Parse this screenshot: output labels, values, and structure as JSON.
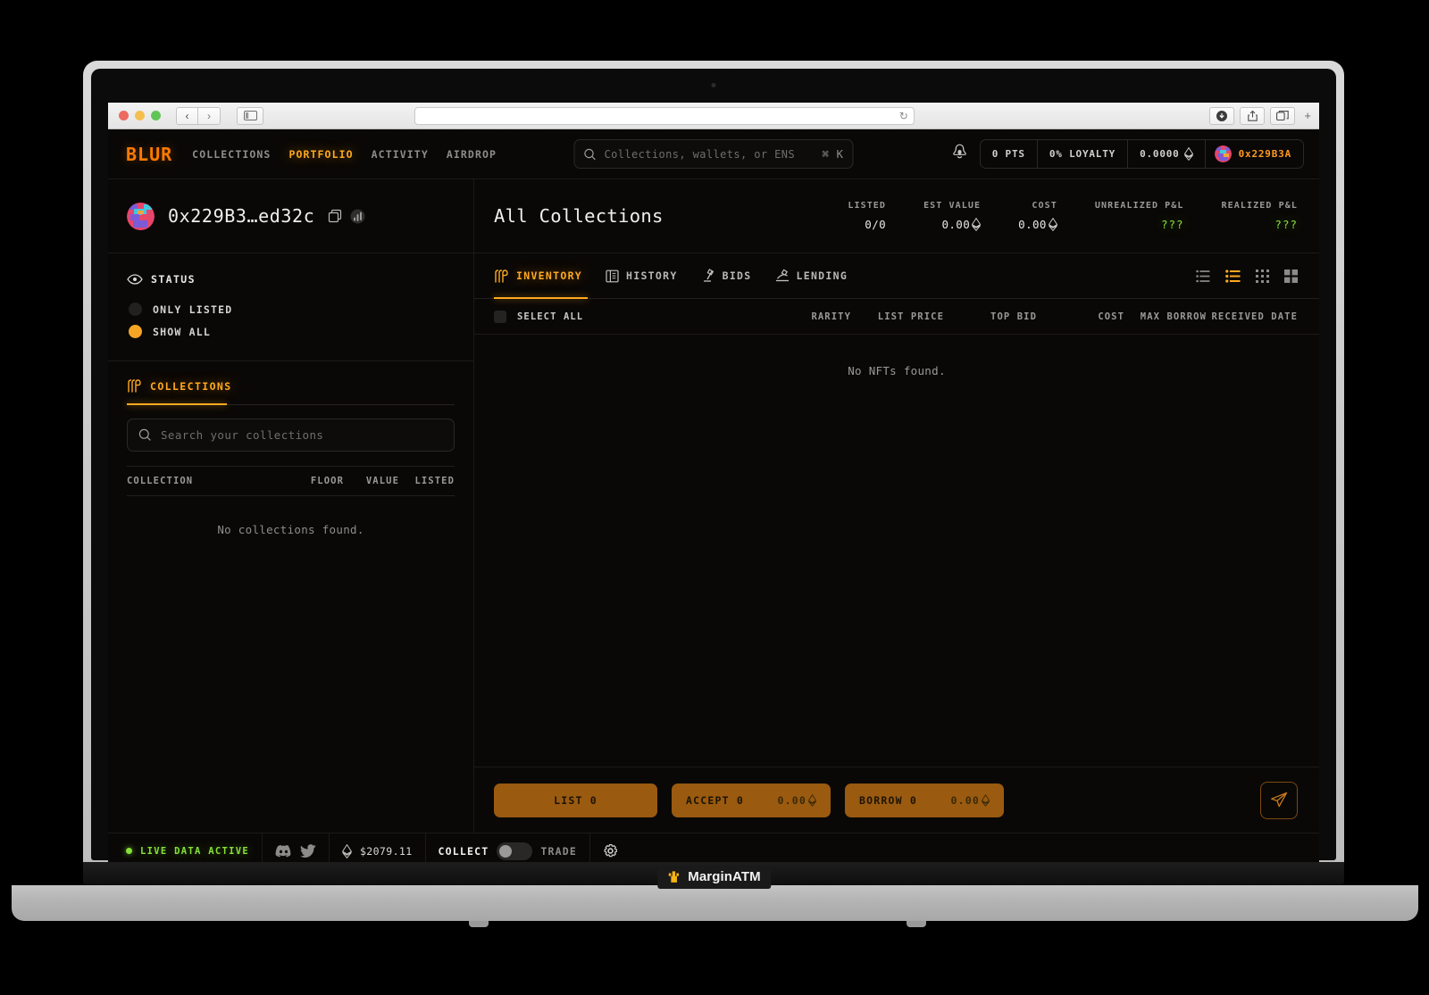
{
  "browser": {
    "traffic_lights": [
      "close",
      "minimize",
      "maximize"
    ],
    "back_label": "‹",
    "forward_label": "›",
    "url_value": "",
    "reload_label": "↻",
    "new_tab_label": "+"
  },
  "topnav": {
    "logo": "BLUR",
    "links": [
      {
        "label": "COLLECTIONS",
        "active": false
      },
      {
        "label": "PORTFOLIO",
        "active": true
      },
      {
        "label": "ACTIVITY",
        "active": false
      },
      {
        "label": "AIRDROP",
        "active": false
      }
    ],
    "search": {
      "placeholder": "Collections, wallets, or ENS",
      "shortcut": "⌘ K"
    },
    "pills": [
      {
        "label": "0 PTS"
      },
      {
        "label": "0% LOYALTY"
      },
      {
        "label": "0.0000"
      },
      {
        "label": "0x229B3A"
      }
    ],
    "eth_symbol": "Ξ"
  },
  "sidebar": {
    "account": {
      "address": "0x229B3…ed32c",
      "copy_icon": "copy-icon",
      "etherscan_icon": "etherscan-icon"
    },
    "status": {
      "title": "STATUS",
      "icon": "eye-icon",
      "options": [
        {
          "label": "ONLY LISTED",
          "selected": false
        },
        {
          "label": "SHOW ALL",
          "selected": true
        }
      ]
    },
    "collections": {
      "title": "COLLECTIONS",
      "icon": "collections-icon",
      "search_placeholder": "Search your collections",
      "columns": [
        "COLLECTION",
        "FLOOR",
        "VALUE",
        "LISTED"
      ],
      "empty_text": "No collections found."
    }
  },
  "main": {
    "title": "All Collections",
    "stats": [
      {
        "key": "LISTED",
        "value": "0/0",
        "eth": false,
        "pnl": false
      },
      {
        "key": "EST VALUE",
        "value": "0.00",
        "eth": true,
        "pnl": false
      },
      {
        "key": "COST",
        "value": "0.00",
        "eth": true,
        "pnl": false
      },
      {
        "key": "UNREALIZED P&L",
        "value": "???",
        "eth": false,
        "pnl": true
      },
      {
        "key": "REALIZED P&L",
        "value": "???",
        "eth": false,
        "pnl": true
      }
    ],
    "tabs": [
      {
        "label": "INVENTORY",
        "icon": "inventory-icon",
        "active": true
      },
      {
        "label": "HISTORY",
        "icon": "history-icon",
        "active": false
      },
      {
        "label": "BIDS",
        "icon": "bids-icon",
        "active": false
      },
      {
        "label": "LENDING",
        "icon": "lending-icon",
        "active": false
      }
    ],
    "view_modes": [
      {
        "icon": "list-compact-icon",
        "active": false
      },
      {
        "icon": "list-detail-icon",
        "active": true
      },
      {
        "icon": "grid-small-icon",
        "active": false
      },
      {
        "icon": "grid-large-icon",
        "active": false
      }
    ],
    "table": {
      "select_all_label": "SELECT ALL",
      "columns": [
        "RARITY",
        "LIST PRICE",
        "TOP BID",
        "COST",
        "MAX BORROW",
        "RECEIVED DATE"
      ],
      "empty_text": "No NFTs found."
    },
    "actions": [
      {
        "label": "LIST 0",
        "amount": "",
        "eth": false
      },
      {
        "label": "ACCEPT 0",
        "amount": "0.00",
        "eth": true
      },
      {
        "label": "BORROW 0",
        "amount": "0.00",
        "eth": true
      }
    ],
    "send_icon": "send-icon"
  },
  "footer": {
    "live_label": "LIVE DATA ACTIVE",
    "discord_icon": "discord-icon",
    "twitter_icon": "twitter-icon",
    "eth_price": "$2079.11",
    "collect_label": "COLLECT",
    "trade_label": "TRADE",
    "settings_icon": "gear-icon"
  },
  "watermark": {
    "label": "MarginATM",
    "icon": "crown-icon"
  },
  "colors": {
    "accent": "#ffa920",
    "brand": "#ff7a00",
    "positive": "#86e03a",
    "button": "#9a5a10",
    "background": "#0a0806"
  }
}
